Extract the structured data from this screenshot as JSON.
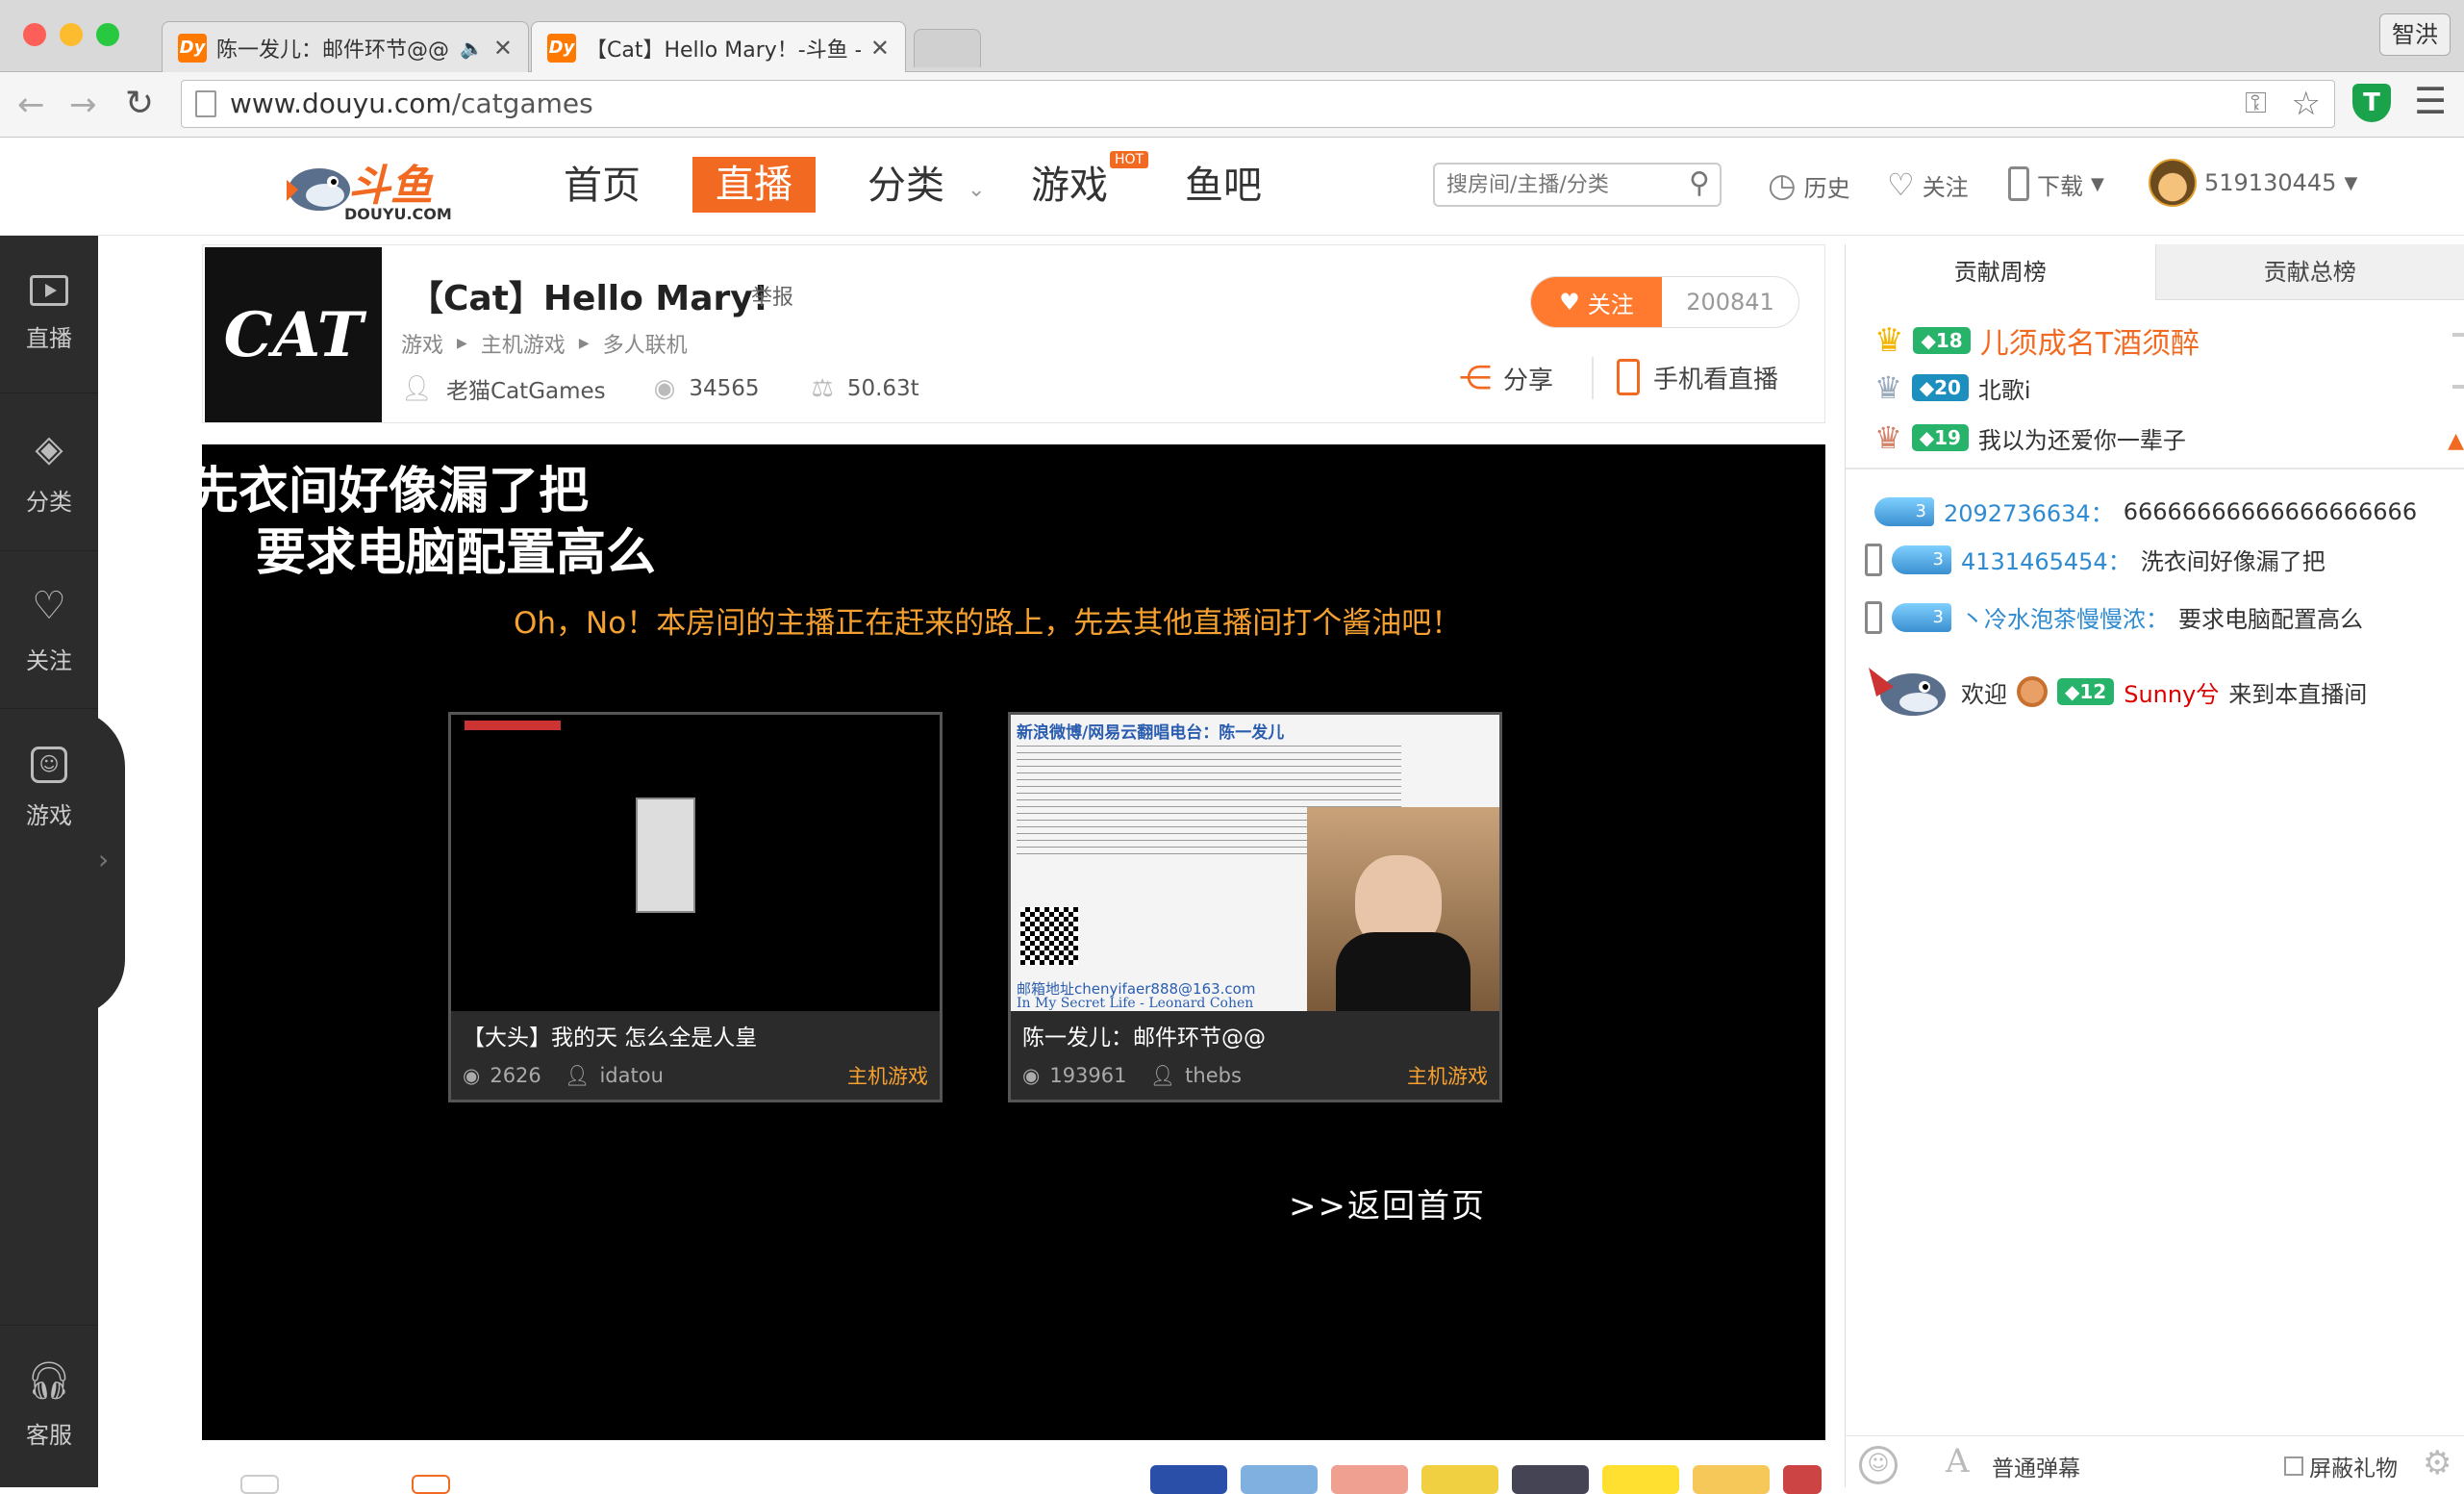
{
  "browser": {
    "tabs": [
      {
        "title": "陈一发儿：邮件环节@@-",
        "icon": "Dy"
      },
      {
        "title": "【Cat】Hello Mary！-斗鱼 -",
        "icon": "Dy"
      }
    ],
    "profile_name": "智洪",
    "url_host": "www.douyu.com",
    "url_path": "/catgames"
  },
  "site": {
    "logo_text": "斗鱼",
    "logo_sub": "DOUYU.COM",
    "nav": {
      "home": "首页",
      "live": "直播",
      "category": "分类",
      "games": "游戏",
      "hot_badge": "HOT",
      "fishbar": "鱼吧"
    },
    "search_placeholder": "搜房间/主播/分类",
    "history": "历史",
    "follow": "关注",
    "download": "下载",
    "user_id": "519130445"
  },
  "sidebar": {
    "live": "直播",
    "category": "分类",
    "follow": "关注",
    "games": "游戏",
    "service": "客服"
  },
  "room": {
    "avatar_text": "CAT",
    "title": "【Cat】Hello Mary!",
    "report": "举报",
    "breadcrumb": [
      "游戏",
      "主机游戏",
      "多人联机"
    ],
    "owner": "老猫CatGames",
    "viewers": "34565",
    "weight": "50.63t",
    "follow_label": "关注",
    "follow_count": "200841",
    "share": "分享",
    "mobile_watch": "手机看直播"
  },
  "player": {
    "danmaku": [
      "先衣间好像漏了把",
      "要求电脑配置高么"
    ],
    "offline_msg": "Oh，No！本房间的主播正在赶来的路上，先去其他直播间打个酱油吧！",
    "cards": [
      {
        "title": "【大头】我的天 怎么全是人皇",
        "views": "2626",
        "owner": "idatou",
        "category": "主机游戏"
      },
      {
        "title": "陈一发儿：邮件环节@@",
        "views": "193961",
        "owner": "thebs",
        "category": "主机游戏",
        "overlay_lines": [
          "新浪微博/网易云翻唱电台：陈一发儿",
          "邮箱地址chenyifaer888@163.com",
          "In My Secret Life - Leonard Cohen"
        ]
      }
    ],
    "back_home": ">>返回首页"
  },
  "ranking": {
    "tabs": [
      "贡献周榜",
      "贡献总榜"
    ],
    "rows": [
      {
        "level": "18",
        "name": "儿须成名T酒须醉"
      },
      {
        "level": "20",
        "name": "北歌i"
      },
      {
        "level": "19",
        "name": "我以为还爱你一辈子"
      }
    ]
  },
  "chat": {
    "messages": [
      {
        "level": "3",
        "user": "2092736634：",
        "text": "66666666666666666666",
        "mobile": false
      },
      {
        "level": "3",
        "user": "4131465454：",
        "text": "洗衣间好像漏了把",
        "mobile": true
      },
      {
        "level": "3",
        "user": "丶冷水泡茶慢慢浓：",
        "text": "要求电脑配置高么",
        "mobile": true
      }
    ],
    "welcome": {
      "prefix": "欢迎",
      "level": "12",
      "user": "Sunny兮",
      "suffix": "来到本直播间"
    },
    "bottom": {
      "mode": "普通弹幕",
      "block_gift": "屏蔽礼物"
    }
  },
  "colors": {
    "accent": "#ff5d23",
    "douyu_orange": "#f26a21",
    "chat_user": "#2e8bd1",
    "gold": "#e8a100"
  }
}
